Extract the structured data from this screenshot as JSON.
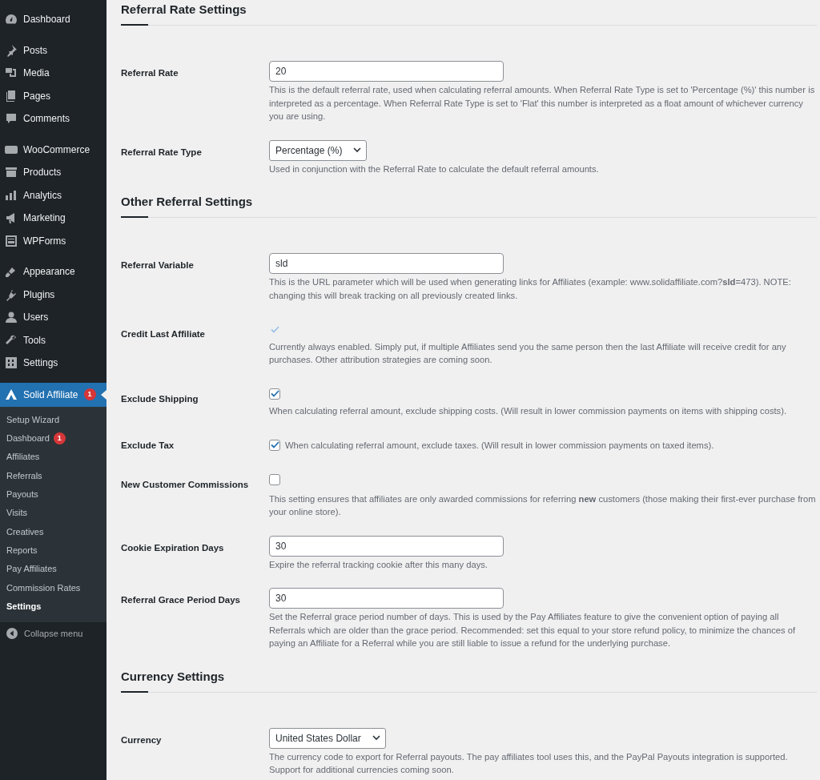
{
  "sidebar": {
    "groups": [
      [
        {
          "label": "Dashboard",
          "selected": false
        }
      ],
      [
        {
          "label": "Posts",
          "selected": false
        },
        {
          "label": "Media",
          "selected": false
        },
        {
          "label": "Pages",
          "selected": false
        },
        {
          "label": "Comments",
          "selected": false
        }
      ],
      [
        {
          "label": "WooCommerce",
          "selected": false
        },
        {
          "label": "Products",
          "selected": false
        },
        {
          "label": "Analytics",
          "selected": false
        },
        {
          "label": "Marketing",
          "selected": false
        },
        {
          "label": "WPForms",
          "selected": false
        }
      ],
      [
        {
          "label": "Appearance",
          "selected": false
        },
        {
          "label": "Plugins",
          "selected": false
        },
        {
          "label": "Users",
          "selected": false
        },
        {
          "label": "Tools",
          "selected": false
        },
        {
          "label": "Settings",
          "selected": false
        }
      ],
      [
        {
          "label": "Solid Affiliate",
          "selected": true,
          "badge": "1",
          "submenu": [
            {
              "label": "Setup Wizard",
              "selected": false
            },
            {
              "label": "Dashboard",
              "selected": false,
              "badge": "1"
            },
            {
              "label": "Affiliates",
              "selected": false
            },
            {
              "label": "Referrals",
              "selected": false
            },
            {
              "label": "Payouts",
              "selected": false
            },
            {
              "label": "Visits",
              "selected": false
            },
            {
              "label": "Creatives",
              "selected": false
            },
            {
              "label": "Reports",
              "selected": false
            },
            {
              "label": "Pay Affiliates",
              "selected": false
            },
            {
              "label": "Commission Rates",
              "selected": false
            },
            {
              "label": "Settings",
              "selected": true
            }
          ]
        }
      ]
    ],
    "collapse_label": "Collapse menu"
  },
  "sections": [
    {
      "title": "Referral Rate Settings",
      "fields": [
        {
          "kind": "text",
          "label": "Referral Rate",
          "value": "20",
          "description": "This is the default referral rate, used when calculating referral amounts. When Referral Rate Type is set to 'Percentage (%)' this number is interpreted as a percentage. When Referral Rate Type is set to 'Flat' this number is interpreted as a float amount of whichever currency you are using."
        },
        {
          "kind": "select",
          "label": "Referral Rate Type",
          "value": "Percentage (%)",
          "description": "Used in conjunction with the Referral Rate to calculate the default referral amounts."
        }
      ]
    },
    {
      "title": "Other Referral Settings",
      "fields": [
        {
          "kind": "text",
          "label": "Referral Variable",
          "value": "sld",
          "description": "This is the URL parameter which will be used when generating links for Affiliates (example: www.solidaffiliate.com?**sld**=473). NOTE: changing this will break tracking on all previously created links."
        },
        {
          "kind": "checkbox",
          "label": "Credit Last Affiliate",
          "checked": true,
          "disabled": true,
          "inline": false,
          "description": "Currently always enabled. Simply put, if multiple Affiliates send you the same person then the last Affiliate will receive credit for any purchases. Other attribution strategies are coming soon."
        },
        {
          "kind": "checkbox",
          "label": "Exclude Shipping",
          "checked": true,
          "disabled": false,
          "inline": false,
          "description": "When calculating referral amount, exclude shipping costs. (Will result in lower commission payments on items with shipping costs)."
        },
        {
          "kind": "checkbox",
          "label": "Exclude Tax",
          "checked": true,
          "disabled": false,
          "inline": true,
          "description": "When calculating referral amount, exclude taxes. (Will result in lower commission payments on taxed items)."
        },
        {
          "kind": "checkbox",
          "label": "New Customer Commissions",
          "checked": false,
          "disabled": false,
          "inline": false,
          "description": "This setting ensures that affiliates are only awarded commissions for referring **new** customers (those making their first-ever purchase from your online store)."
        },
        {
          "kind": "text",
          "label": "Cookie Expiration Days",
          "value": "30",
          "description": "Expire the referral tracking cookie after this many days."
        },
        {
          "kind": "text",
          "label": "Referral Grace Period Days",
          "value": "30",
          "description": "Set the Referral grace period number of days. This is used by the Pay Affiliates feature to give the convenient option of paying all Referrals which are older than the grace period. Recommended: set this equal to your store refund policy, to minimize the chances of paying an Affiliate for a Referral while you are still liable to issue a refund for the underlying purchase."
        }
      ]
    },
    {
      "title": "Currency Settings",
      "fields": [
        {
          "kind": "select",
          "label": "Currency",
          "value": "United States Dollar",
          "description": "The currency code to export for Referral payouts. The pay affiliates tool uses this, and the PayPal Payouts integration is supported. Support for additional currencies coming soon."
        }
      ]
    }
  ]
}
